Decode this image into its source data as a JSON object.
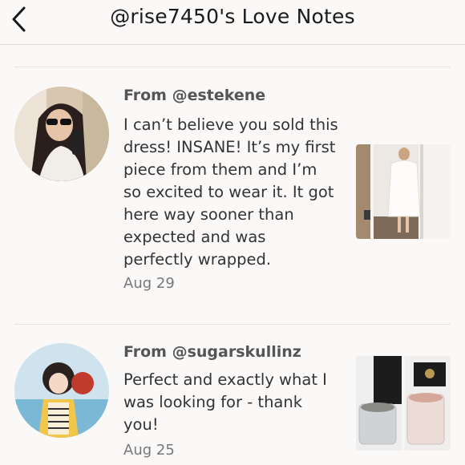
{
  "header": {
    "title": "@rise7450's Love Notes"
  },
  "notes": [
    {
      "from": "From @estekene",
      "message": "I can’t believe you sold this dress! INSANE! It’s my first piece from them and I’m so excited to wear it. It got here way sooner than expected and was perfectly wrapped.",
      "date": "Aug 29"
    },
    {
      "from": "From @sugarskullinz",
      "message": "Perfect and exactly what I was looking for - thank you!",
      "date": "Aug 25"
    }
  ],
  "icons": {
    "back": "chevron-left-icon"
  },
  "colors": {
    "background": "#fbf8f8",
    "text": "#333333",
    "secondary_text": "#777777"
  }
}
